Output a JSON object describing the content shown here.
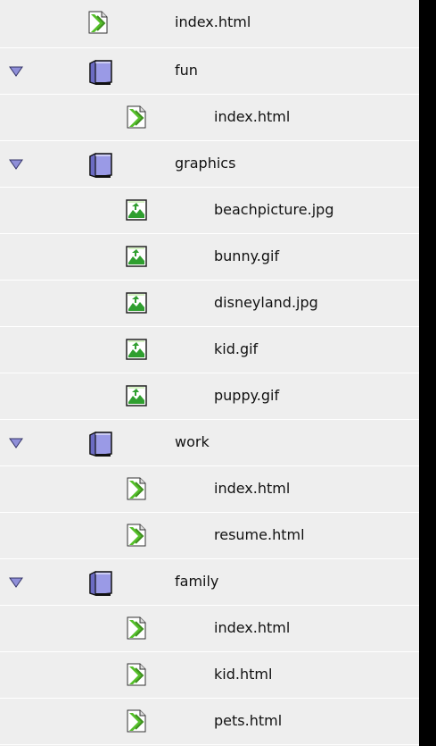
{
  "rows": [
    {
      "kind": "html",
      "level": 0,
      "label": "index.html",
      "icon": "html-file-icon"
    },
    {
      "kind": "folder",
      "level": 0,
      "label": "fun",
      "icon": "folder-icon",
      "expanded": true
    },
    {
      "kind": "html",
      "level": 1,
      "label": "index.html",
      "icon": "html-file-icon"
    },
    {
      "kind": "folder",
      "level": 0,
      "label": "graphics",
      "icon": "folder-icon",
      "expanded": true
    },
    {
      "kind": "image",
      "level": 1,
      "label": "beachpicture.jpg",
      "icon": "image-file-icon"
    },
    {
      "kind": "image",
      "level": 1,
      "label": "bunny.gif",
      "icon": "image-file-icon"
    },
    {
      "kind": "image",
      "level": 1,
      "label": "disneyland.jpg",
      "icon": "image-file-icon"
    },
    {
      "kind": "image",
      "level": 1,
      "label": "kid.gif",
      "icon": "image-file-icon"
    },
    {
      "kind": "image",
      "level": 1,
      "label": "puppy.gif",
      "icon": "image-file-icon"
    },
    {
      "kind": "folder",
      "level": 0,
      "label": "work",
      "icon": "folder-icon",
      "expanded": true
    },
    {
      "kind": "html",
      "level": 1,
      "label": "index.html",
      "icon": "html-file-icon"
    },
    {
      "kind": "html",
      "level": 1,
      "label": "resume.html",
      "icon": "html-file-icon"
    },
    {
      "kind": "folder",
      "level": 0,
      "label": "family",
      "icon": "folder-icon",
      "expanded": true
    },
    {
      "kind": "html",
      "level": 1,
      "label": "index.html",
      "icon": "html-file-icon"
    },
    {
      "kind": "html",
      "level": 1,
      "label": "kid.html",
      "icon": "html-file-icon"
    },
    {
      "kind": "html",
      "level": 1,
      "label": "pets.html",
      "icon": "html-file-icon"
    }
  ],
  "colors": {
    "pane_background": "#eeeeee",
    "row_separator": "#ffffff",
    "folder_body": "#9a9ae6",
    "html_icon_green": "#55c02a",
    "image_icon_green": "#2f9f2f",
    "disclosure_triangle": "#8f8fd8"
  }
}
